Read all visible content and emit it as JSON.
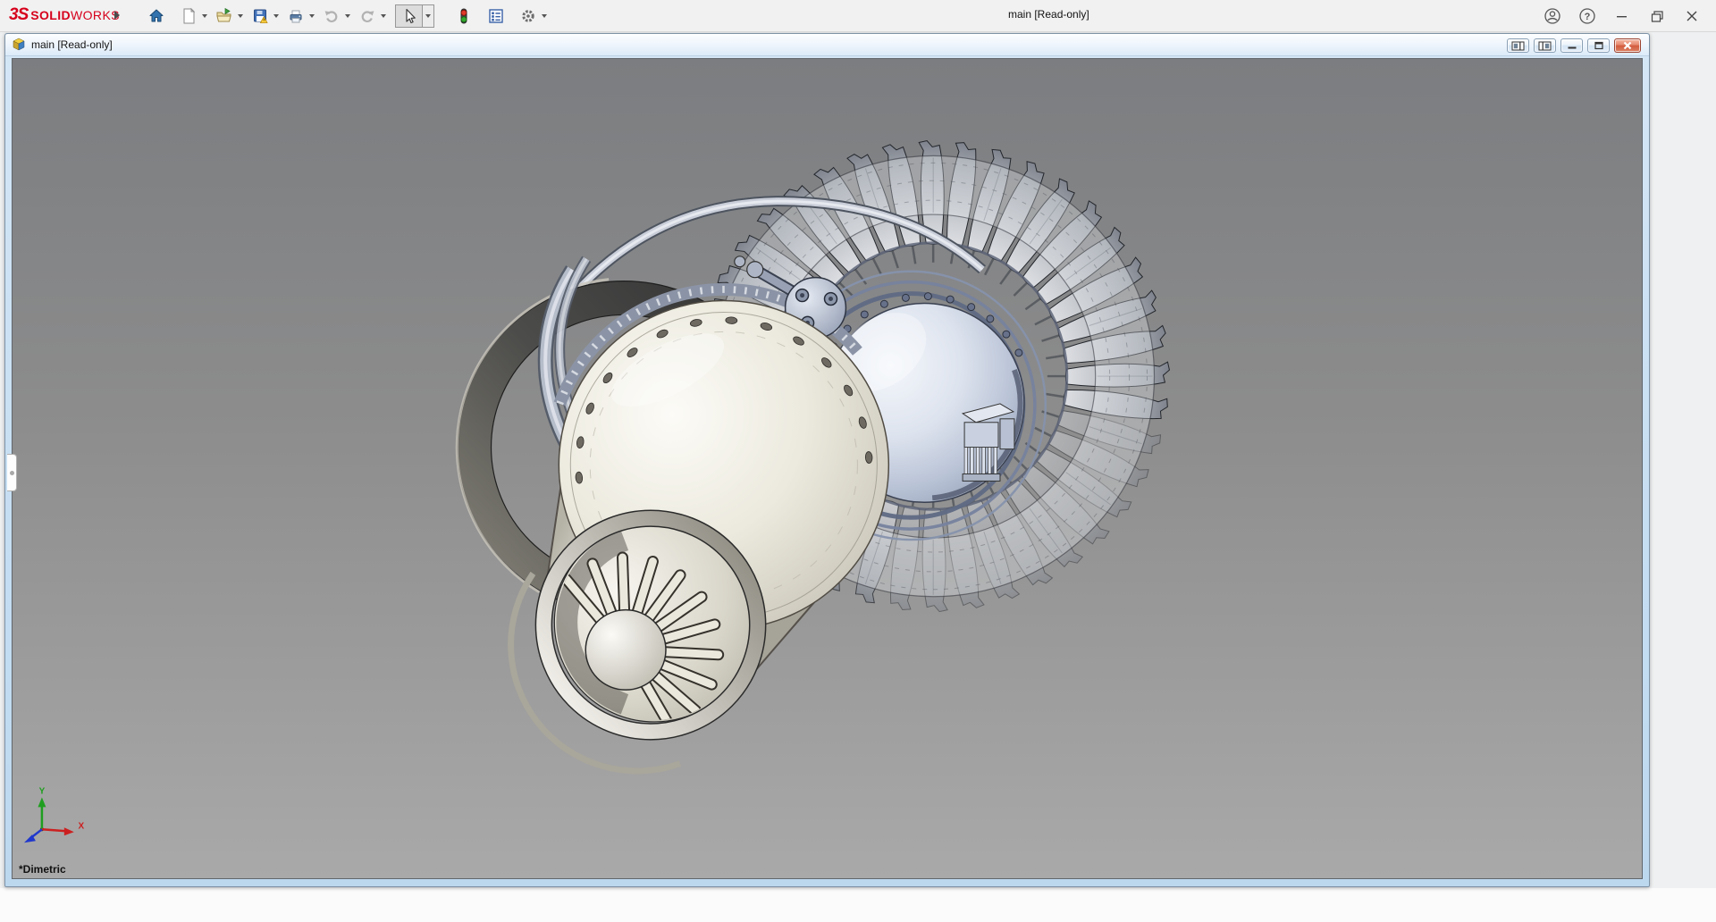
{
  "app": {
    "logo": {
      "brand_mark": "3S",
      "brand_bold": "SOLID",
      "brand_light": "WORKS"
    },
    "title": "main [Read-only]",
    "help_glyph": "?",
    "toolbar_icons": [
      "flyout-arrow",
      "home",
      "new-document",
      "open",
      "save",
      "print",
      "undo",
      "redo",
      "select",
      "rebuild",
      "file-properties",
      "options"
    ],
    "titlebar_icons": [
      "account",
      "help",
      "minimize",
      "maximize",
      "close"
    ]
  },
  "document_window": {
    "title": "main [Read-only]",
    "controls": [
      "show-left-pane",
      "show-right-pane",
      "minimize",
      "restore",
      "close"
    ]
  },
  "viewport": {
    "orientation_label": "*Dimetric",
    "triad": {
      "x_label": "X",
      "y_label": "Y"
    },
    "model": "jet-engine-turbine-assembly"
  },
  "colors": {
    "solidworks_red": "#d6001c",
    "viewport_gray_top": "#7b7d80",
    "viewport_gray_bottom": "#a9a9a9",
    "close_button_red": "#d25a3d",
    "triad_x": "#cc2020",
    "triad_y": "#1f9e1f",
    "triad_z": "#2038cc",
    "model_cream": "#ece9df",
    "model_blue_gray": "#b9c3d6",
    "model_dark_ring": "#3b3b3b"
  }
}
